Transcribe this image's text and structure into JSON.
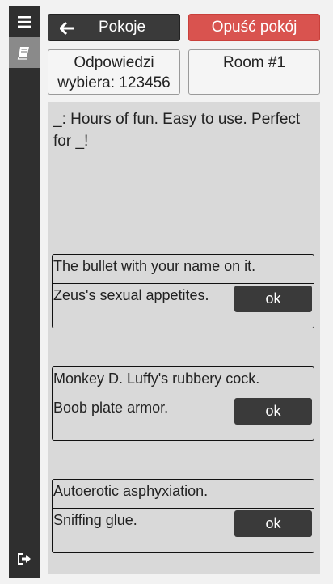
{
  "header": {
    "back_label": "Pokoje",
    "leave_label": "Opuść pokój",
    "chooser_line1": "Odpowiedzi",
    "chooser_line2": "wybiera: 123456",
    "room_label": "Room #1"
  },
  "question": "_: Hours of fun. Easy to use. Perfect for _!",
  "cards": [
    {
      "answer1": "The bullet with your name on it.",
      "answer2": "Zeus's sexual appetites.",
      "ok": "ok"
    },
    {
      "answer1": "Monkey D. Luffy's rubbery cock.",
      "answer2": "Boob plate armor.",
      "ok": "ok"
    },
    {
      "answer1": "Autoerotic asphyxiation.",
      "answer2": "Sniffing glue.",
      "ok": "ok"
    }
  ],
  "icons": {
    "menu": "hamburger-menu-icon",
    "book": "book-icon",
    "logout": "sign-out-icon",
    "back": "arrow-left-icon"
  },
  "colors": {
    "dark": "#3a3a3a",
    "danger": "#d9534f",
    "panel": "#d9d9d9"
  }
}
